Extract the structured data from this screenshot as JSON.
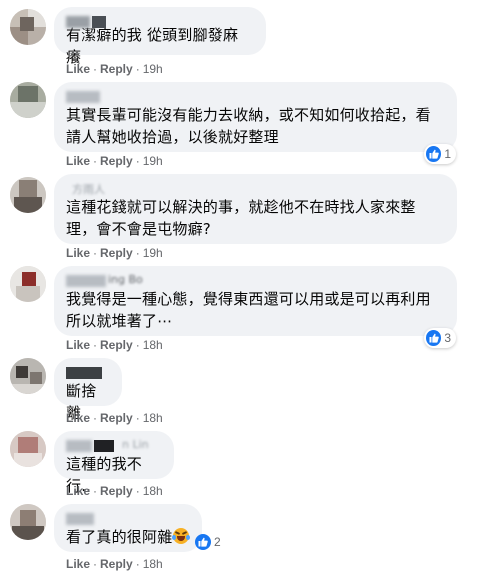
{
  "actions": {
    "like": "Like",
    "reply": "Reply",
    "separator": "·"
  },
  "colors": {
    "bubble": "#f0f2f5",
    "like_blue": "#1877f2",
    "meta_gray": "#65676b"
  },
  "comments": [
    {
      "text": "有潔癖的我 從頭到腳發麻 癢",
      "time": "19h"
    },
    {
      "text": "其實長輩可能沒有能力去收納，或不知如何收拾起，看請人幫她收拾過，以後就好整理",
      "time": "19h",
      "reactions": {
        "icon": "like-icon",
        "count": "1"
      }
    },
    {
      "author_partial": "方雨人",
      "text": "這種花錢就可以解決的事，就趁他不在時找人家來整理，會不會是屯物癖?",
      "time": "19h"
    },
    {
      "author_partial": "ing Bo",
      "text": "我覺得是一種心態，覺得東西還可以用或是可以再利用所以就堆著了⋯",
      "time": "18h",
      "reactions": {
        "icon": "like-icon",
        "count": "3"
      }
    },
    {
      "text": "斷捨離",
      "time": "18h"
    },
    {
      "author_partial": "n Lin",
      "text": "這種的我不行..",
      "time": "18h"
    },
    {
      "text": "看了真的很阿雜",
      "emoji": "rolling-laughing-emoji",
      "time": "18h",
      "reactions": {
        "icon": "like-icon",
        "count": "2"
      }
    }
  ]
}
